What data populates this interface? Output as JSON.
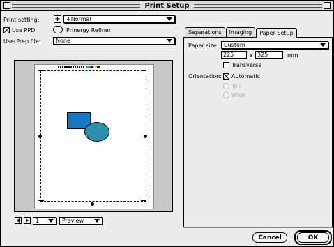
{
  "window": {
    "title": "Print Setup"
  },
  "print_setting": {
    "label": "Print setting:",
    "value": "+Normal",
    "add_symbol": "+"
  },
  "use_ppd": {
    "label": "Use PPD",
    "checked": true
  },
  "prinergy_refiner": {
    "label": "Prinergy Refiner"
  },
  "userprep": {
    "label": "UserPrep file:",
    "value": "None"
  },
  "preview_controls": {
    "page_number": "1",
    "mode": "Preview"
  },
  "tabs": [
    {
      "label": "Separations",
      "active": false
    },
    {
      "label": "Imaging",
      "active": false
    },
    {
      "label": "Paper Setup",
      "active": true
    }
  ],
  "paper_setup": {
    "paper_size_label": "Paper size:",
    "paper_size_value": "Custom",
    "width": "225",
    "times": "x",
    "height": "325",
    "unit": "mm",
    "transverse_label": "Transverse",
    "transverse_checked": false,
    "orientation_label": "Orientation:",
    "automatic_label": "Automatic",
    "automatic_checked": true,
    "tall_label": "Tall",
    "wide_label": "Wide"
  },
  "buttons": {
    "cancel": "Cancel",
    "ok": "OK"
  },
  "colors": {
    "rect_fill": "#1a78c2",
    "ellipse_fill": "#2a8fae"
  }
}
